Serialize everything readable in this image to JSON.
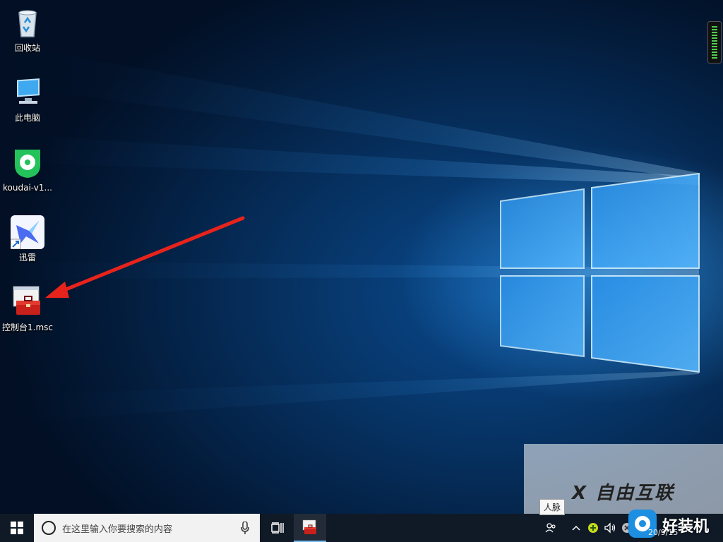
{
  "desktop": {
    "icons": [
      {
        "label": "回收站",
        "icon": "recycle-bin-icon"
      },
      {
        "label": "此电脑",
        "icon": "this-pc-icon"
      },
      {
        "label": "koudai-v1...",
        "icon": "koudai-icon"
      },
      {
        "label": "迅雷",
        "icon": "xunlei-icon"
      },
      {
        "label": "控制台1.msc",
        "icon": "msc-console-icon"
      }
    ]
  },
  "taskbar": {
    "search_placeholder": "在这里输入你要搜索的内容",
    "pinned_app": "msc-console-icon",
    "tooltip": "人脉",
    "clock_date": "20/9/15"
  },
  "watermark": {
    "brand": "X 自由互联",
    "brand2": "好装机"
  },
  "colors": {
    "arrow": "#e8231c",
    "taskbar": "#101a26",
    "accent": "#76b9ed"
  }
}
